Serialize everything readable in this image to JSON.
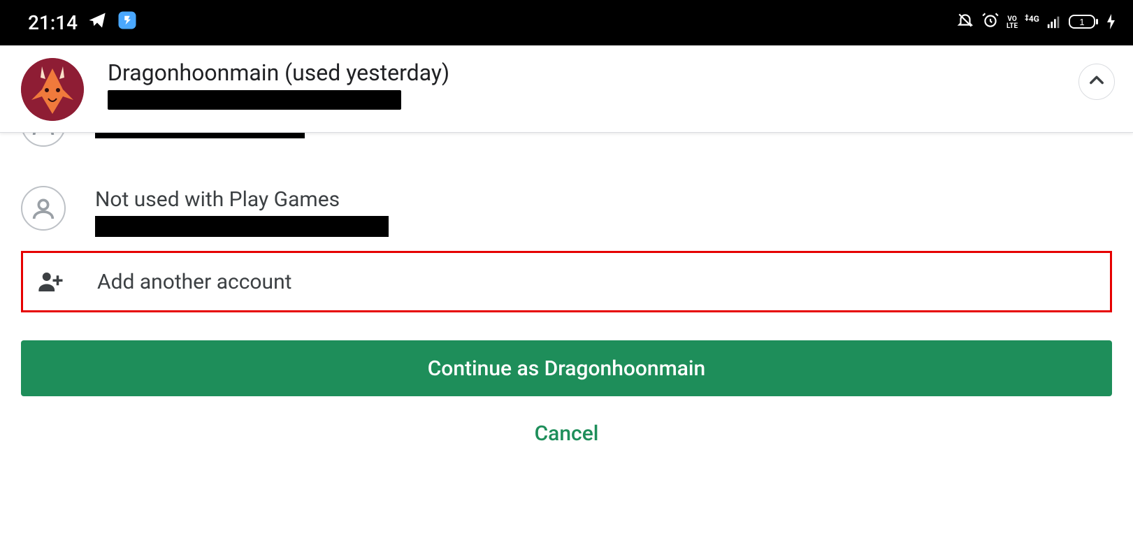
{
  "status": {
    "time": "21:14",
    "net_label": "4G",
    "volte_label": "VO\nLTE",
    "battery_label": "1"
  },
  "header": {
    "primary_name": "Dragonhoonmain (used yesterday)"
  },
  "accounts": {
    "third": {
      "title": "Not used with Play Games"
    }
  },
  "add": {
    "label": "Add another account"
  },
  "actions": {
    "continue": "Continue as Dragonhoonmain",
    "cancel": "Cancel"
  }
}
